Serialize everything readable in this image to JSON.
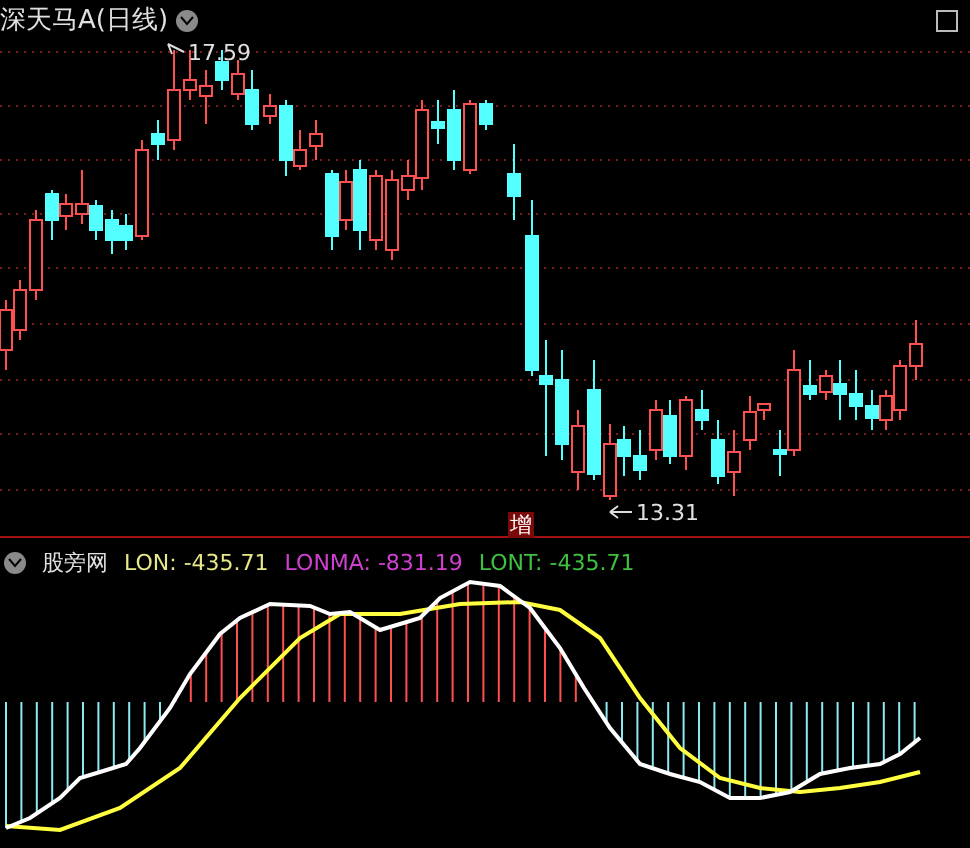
{
  "price_chart": {
    "title": "深天马A(日线)",
    "high_label": "17.59",
    "low_label": "13.31",
    "marker": "增"
  },
  "indicator": {
    "name": "股旁网",
    "values": [
      {
        "text": "LON: -435.71",
        "color": "#e6e68a"
      },
      {
        "text": "LONMA: -831.19",
        "color": "#d040d0"
      },
      {
        "text": "LONT: -435.71",
        "color": "#40c040"
      }
    ]
  }
}
